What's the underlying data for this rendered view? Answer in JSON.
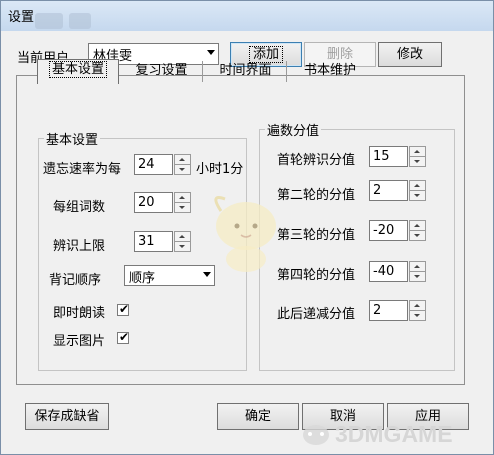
{
  "window": {
    "title": "设置"
  },
  "user": {
    "label": "当前用户",
    "current": "林佳雯"
  },
  "buttons": {
    "add": "添加",
    "delete": "删除",
    "modify": "修改",
    "save_default": "保存成缺省",
    "ok": "确定",
    "cancel": "取消",
    "apply": "应用"
  },
  "tabs": [
    {
      "label": "基本设置"
    },
    {
      "label": "复习设置"
    },
    {
      "label": "时间界面"
    },
    {
      "label": "书本维护"
    }
  ],
  "basic": {
    "group_title": "基本设置",
    "forget_rate": {
      "label": "遗忘速率为每",
      "value": "24",
      "unit": "小时1分"
    },
    "words_per_group": {
      "label": "每组词数",
      "value": "20"
    },
    "recognize_limit": {
      "label": "辨识上限",
      "value": "31"
    },
    "order": {
      "label": "背记顺序",
      "value": "顺序"
    },
    "read_aloud": {
      "label": "即时朗读",
      "checked": true
    },
    "show_image": {
      "label": "显示图片",
      "checked": true
    }
  },
  "scores": {
    "group_title": "遍数分值",
    "items": [
      {
        "label": "首轮辨识分值",
        "value": "15"
      },
      {
        "label": "第二轮的分值",
        "value": "2"
      },
      {
        "label": "第三轮的分值",
        "value": "-20"
      },
      {
        "label": "第四轮的分值",
        "value": "-40"
      },
      {
        "label": "此后递减分值",
        "value": "2"
      }
    ]
  },
  "watermark": "3DMGAME",
  "colors": {
    "title_bar": "#c5d8ee",
    "dialog_bg": "#f0f0f0",
    "focus_border": "#3c7fb1",
    "watermark": "#d6d6d6"
  }
}
